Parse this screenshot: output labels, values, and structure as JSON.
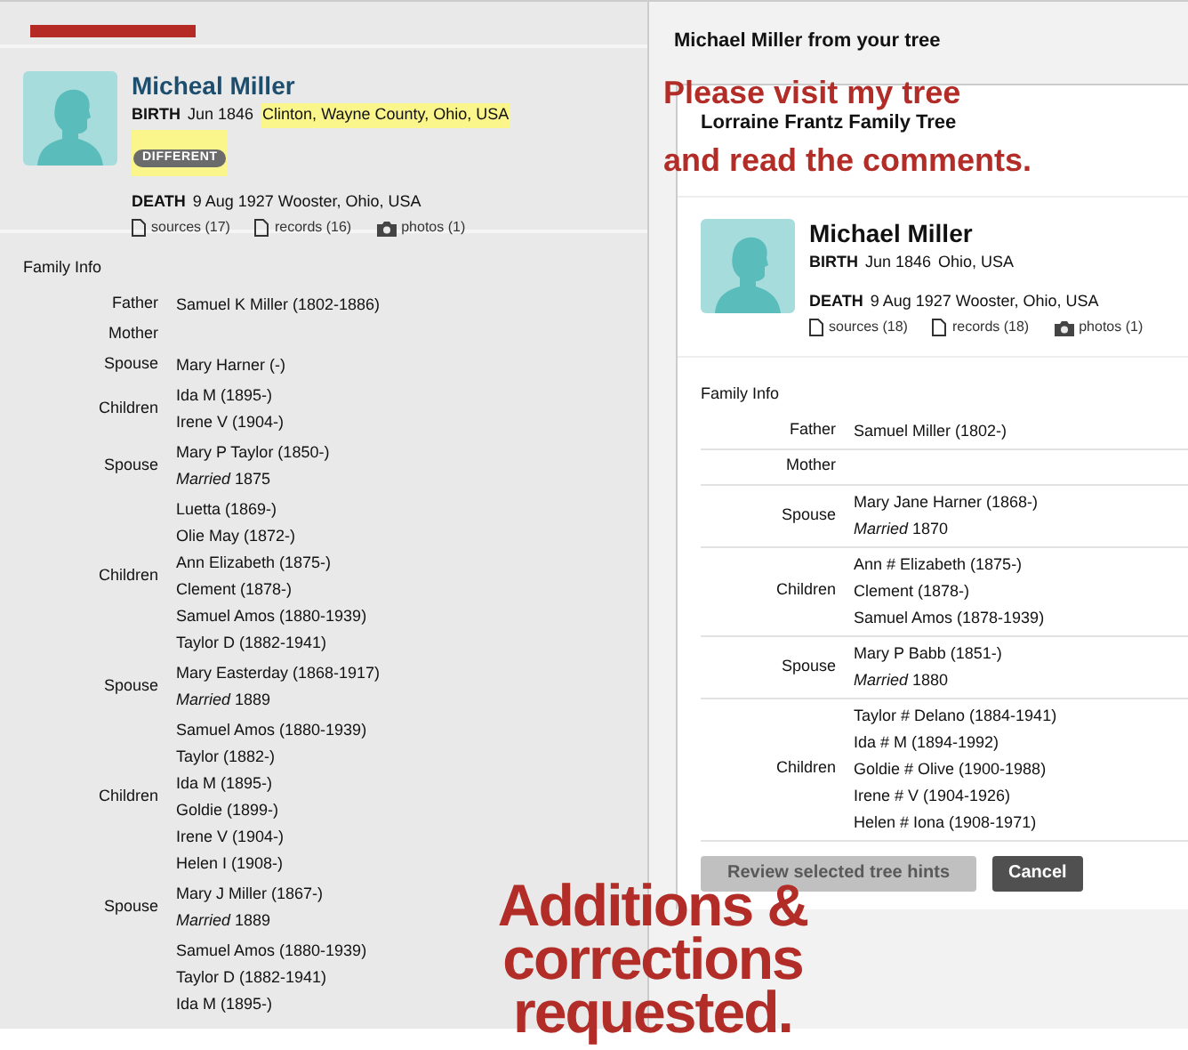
{
  "left_panel": {
    "person": {
      "name": "Micheal Miller",
      "birth_label": "BIRTH",
      "birth_date": "Jun 1846",
      "birth_place": "Clinton, Wayne County, Ohio, USA",
      "birth_place_highlighted": true,
      "badge": "DIFFERENT",
      "death_label": "DEATH",
      "death_text": "9 Aug 1927 Wooster, Ohio, USA",
      "counts": [
        {
          "kind": "document",
          "text": "sources (17)"
        },
        {
          "kind": "document",
          "text": "records (16)"
        },
        {
          "kind": "camera",
          "text": "photos (1)"
        }
      ]
    },
    "family_title": "Family Info",
    "family": [
      {
        "role": "Father",
        "lines": [
          "Samuel K Miller (1802-1886)"
        ]
      },
      {
        "role": "Mother"
      },
      {
        "role": "Spouse",
        "lines": [
          "Mary Harner (-)"
        ]
      },
      {
        "role": "Children",
        "lines": [
          "Ida M (1895-)",
          "Irene V (1904-)"
        ]
      },
      {
        "role": "Spouse",
        "lines": [
          "Mary P Taylor (1850-)",
          "*Married* 1875"
        ]
      },
      {
        "role": "Children",
        "lines": [
          "Luetta (1869-)",
          "Olie May (1872-)",
          "Ann Elizabeth (1875-)",
          "Clement (1878-)",
          "Samuel Amos (1880-1939)",
          "Taylor D (1882-1941)"
        ]
      },
      {
        "role": "Spouse",
        "lines": [
          "Mary Easterday (1868-1917)",
          "*Married* 1889"
        ]
      },
      {
        "role": "Children",
        "lines": [
          "Samuel Amos (1880-1939)",
          "Taylor (1882-)",
          "Ida M (1895-)",
          "Goldie (1899-)",
          "Irene V (1904-)",
          "Helen I (1908-)"
        ]
      },
      {
        "role": "Spouse",
        "lines": [
          "Mary J Miller (1867-)",
          "*Married* 1889"
        ]
      },
      {
        "lines": [
          "Samuel Amos (1880-1939)",
          "Taylor D (1882-1941)",
          "Ida M (1895-)"
        ]
      }
    ]
  },
  "right_panel": {
    "title": "Michael Miller from your tree",
    "tree_name": "Lorraine Frantz Family Tree",
    "person": {
      "name": "Michael Miller",
      "birth_label": "BIRTH",
      "birth_date": "Jun 1846",
      "birth_place": "Ohio, USA",
      "birth_place_highlighted": false,
      "death_label": "DEATH",
      "death_text": "9 Aug 1927 Wooster, Ohio, USA",
      "counts": [
        {
          "kind": "document",
          "text": "sources (18)"
        },
        {
          "kind": "document",
          "text": "records (18)"
        },
        {
          "kind": "camera",
          "text": "photos (1)"
        }
      ]
    },
    "family_title": "Family Info",
    "family": [
      {
        "role": "Father",
        "lines": [
          "Samuel Miller (1802-)"
        ]
      },
      {
        "role": "Mother"
      },
      {
        "role": "Spouse",
        "lines": [
          "Mary Jane Harner (1868-)",
          "*Married* 1870"
        ]
      },
      {
        "role": "Children",
        "lines": [
          "Ann # Elizabeth (1875-)",
          "Clement (1878-)",
          "Samuel Amos (1878-1939)"
        ]
      },
      {
        "role": "Spouse",
        "lines": [
          "Mary P Babb (1851-)",
          "*Married* 1880"
        ]
      },
      {
        "role": "Children",
        "lines": [
          "Taylor # Delano (1884-1941)",
          "Ida # M (1894-1992)",
          "Goldie # Olive (1900-1988)",
          "Irene # V (1904-1926)",
          "Helen # Iona (1908-1971)"
        ]
      }
    ],
    "buttons": [
      {
        "label": "Review selected tree hints",
        "disabled": true
      },
      {
        "label": "Cancel",
        "disabled": false
      }
    ]
  },
  "annotations": [
    {
      "kind": "note",
      "lines": [
        "Please visit my tree",
        "and read the comments."
      ]
    },
    {
      "kind": "banner",
      "lines": [
        "Additions &",
        "corrections",
        "requested."
      ]
    }
  ]
}
